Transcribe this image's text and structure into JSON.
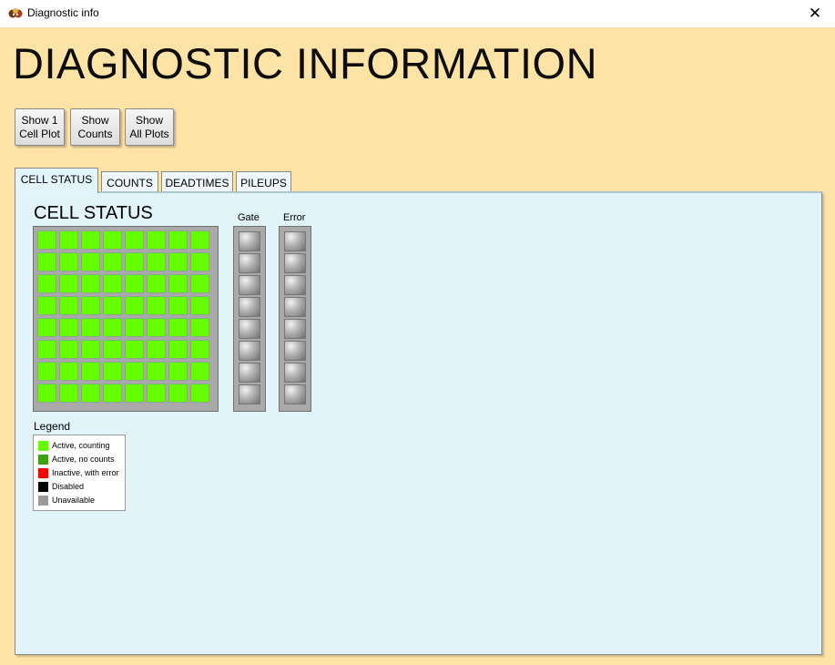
{
  "window": {
    "title": "Diagnostic info",
    "close_symbol": "✕",
    "app_icon": "app-icon",
    "close_icon": "close-icon"
  },
  "main_title": "DIAGNOSTIC INFORMATION",
  "toolbar": {
    "buttons": [
      {
        "line1": "Show 1",
        "line2": "Cell Plot"
      },
      {
        "line1": "Show",
        "line2": "Counts"
      },
      {
        "line1": "Show",
        "line2": "All Plots"
      }
    ]
  },
  "tabs": [
    {
      "label": "CELL STATUS",
      "active": true
    },
    {
      "label": "COUNTS",
      "active": false
    },
    {
      "label": "DEADTIMES",
      "active": false
    },
    {
      "label": "PILEUPS",
      "active": false
    }
  ],
  "cell_status": {
    "title": "CELL STATUS",
    "grid": {
      "rows": 8,
      "cols": 8,
      "state": "Active, counting"
    },
    "gate_label": "Gate",
    "error_label": "Error",
    "indicator_count": 8,
    "indicator_icon": "led-indicator-icon"
  },
  "legend": {
    "title": "Legend",
    "items": [
      {
        "label": "Active, counting",
        "color": "#66ff00"
      },
      {
        "label": "Active, no counts",
        "color": "#3fa012"
      },
      {
        "label": "Inactive, with error",
        "color": "#ff0000"
      },
      {
        "label": "Disabled",
        "color": "#000000"
      },
      {
        "label": "Unavailable",
        "color": "#9a9a9a"
      }
    ]
  },
  "colors": {
    "window_background": "#fee3a6",
    "panel_background": "#e0f4f9",
    "cell_active_counting": "#66ff00"
  }
}
